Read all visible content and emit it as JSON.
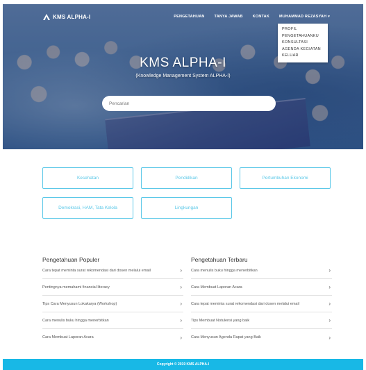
{
  "nav": {
    "brand": "KMS ALPHA-I",
    "links": [
      "PENGETAHUAN",
      "TANYA JAWAB",
      "KONTAK"
    ],
    "user": "MUHAMMAD REZASYAH"
  },
  "user_menu": {
    "items": [
      "PROFIL",
      "PENGETAHUANKU",
      "KONSULTASI",
      "AGENDA KEGIATAN",
      "KELUAR"
    ]
  },
  "hero": {
    "title": "KMS ALPHA-I",
    "subtitle": "(Knowledge Management System ALPHA-I)",
    "search_placeholder": "Pencarian"
  },
  "categories": [
    "Kesehatan",
    "Pendidikan",
    "Pertumbuhan Ekonomi",
    "Demokrasi, HAM, Tata Kelola",
    "Lingkungan"
  ],
  "popular": {
    "title": "Pengetahuan Populer",
    "items": [
      "Cara tepat meminta surat rekomendasi dari dosen melalui email",
      "Pentingnya memahami financial literacy",
      "Tips Cara Menyusun Lokakarya (Workshop)",
      "Cara menulis buku hingga menerbitkan",
      "Cara Membuat Laporan Acara"
    ]
  },
  "latest": {
    "title": "Pengetahuan Terbaru",
    "items": [
      "Cara menulis buku hingga menerbitkan",
      "Cara Membuat Laporan Acara",
      "Cara tepat meminta surat rekomendasi dari dosen melalui email",
      "Tips Membuat Notulensi yang baik",
      "Cara Menyusun Agenda Rapat yang Baik"
    ]
  },
  "footer": {
    "text": "Copyright © 2019 KMS ALPHA-I"
  },
  "colors": {
    "accent": "#5bc8e8",
    "footer": "#18b8e6"
  }
}
